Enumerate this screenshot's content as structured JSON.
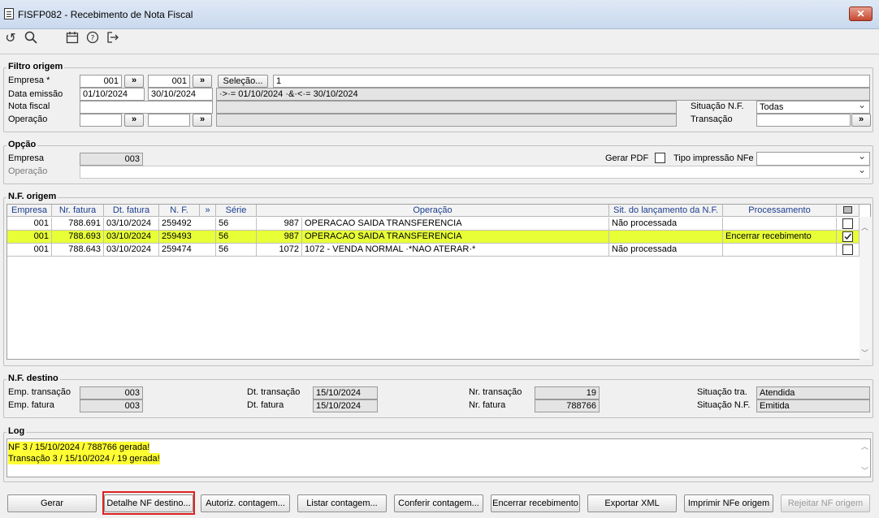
{
  "window": {
    "title": "FISFP082 - Recebimento de Nota Fiscal",
    "close_glyph": "✕"
  },
  "toolbar": {
    "icons": [
      "undo-icon",
      "search-icon",
      "calendar-icon",
      "help-icon",
      "exit-icon"
    ]
  },
  "filtro": {
    "title": "Filtro origem",
    "empresa_label": "Empresa *",
    "empresa_from": "001",
    "empresa_to": "001",
    "arrow": "»",
    "selecao_button": "Seleção...",
    "selecao_value": "1",
    "data_label": "Data emissão",
    "data_from": "01/10/2024",
    "data_to": "30/10/2024",
    "data_expr": "·>·= 01/10/2024 ·&·<·= 30/10/2024",
    "nota_label": "Nota fiscal",
    "operacao_label": "Operação",
    "situacao_label": "Situação N.F.",
    "situacao_value": "Todas",
    "transacao_label": "Transação"
  },
  "opcao": {
    "title": "Opção",
    "empresa_label": "Empresa",
    "empresa_value": "003",
    "gerar_pdf_label": "Gerar PDF",
    "tipo_label": "Tipo impressão NFe",
    "operacao_label": "Operação"
  },
  "nf_origem": {
    "title": "N.F. origem",
    "headers": [
      "Empresa",
      "Nr. fatura",
      "Dt. fatura",
      "N. F.",
      "»",
      "Série",
      "Operação",
      "Sit. do lançamento da N.F.",
      "Processamento"
    ],
    "rows": [
      {
        "empresa": "001",
        "fatura": "788.691",
        "dt": "03/10/2024",
        "nf": "259492",
        "serie": "56",
        "op_code": "987",
        "op_desc": "OPERACAO SAIDA TRANSFERENCIA",
        "sit": "Não processada",
        "proc": "",
        "checked": false
      },
      {
        "empresa": "001",
        "fatura": "788.693",
        "dt": "03/10/2024",
        "nf": "259493",
        "serie": "56",
        "op_code": "987",
        "op_desc": "OPERACAO SAIDA TRANSFERENCIA",
        "sit": "",
        "proc": "Encerrar recebimento",
        "checked": true
      },
      {
        "empresa": "001",
        "fatura": "788.643",
        "dt": "03/10/2024",
        "nf": "259474",
        "serie": "56",
        "op_code": "1072",
        "op_desc": "1072 - VENDA NORMAL ·*NAO ATERAR·*",
        "sit": "Não processada",
        "proc": "",
        "checked": false
      }
    ]
  },
  "nf_destino": {
    "title": "N.F. destino",
    "emp_transacao_label": "Emp. transação",
    "emp_transacao": "003",
    "emp_fatura_label": "Emp. fatura",
    "emp_fatura": "003",
    "dt_transacao_label": "Dt. transação",
    "dt_transacao": "15/10/2024",
    "dt_fatura_label": "Dt. fatura",
    "dt_fatura": "15/10/2024",
    "nr_transacao_label": "Nr. transação",
    "nr_transacao": "19",
    "nr_fatura_label": "Nr. fatura",
    "nr_fatura": "788766",
    "sit_tra_label": "Situação tra.",
    "sit_tra": "Atendida",
    "sit_nf_label": "Situação N.F.",
    "sit_nf": "Emitida"
  },
  "log": {
    "title": "Log",
    "lines": [
      "NF 3 / 15/10/2024 / 788766 gerada!",
      "Transação 3 / 15/10/2024 / 19 gerada!"
    ]
  },
  "buttons": {
    "gerar": "Gerar",
    "detalhe": "Detalhe NF destino...",
    "autoriz": "Autoriz. contagem...",
    "listar": "Listar contagem...",
    "conferir": "Conferir contagem...",
    "encerrar": "Encerrar recebimento",
    "exportar": "Exportar XML",
    "imprimir": "Imprimir NFe origem",
    "rejeitar": "Rejeitar NF origem"
  },
  "colors": {
    "highlight_row": "#e8ff38",
    "log_highlight": "#ffff33",
    "focus_outline": "#e02020",
    "header_text": "#1a3d8f"
  }
}
